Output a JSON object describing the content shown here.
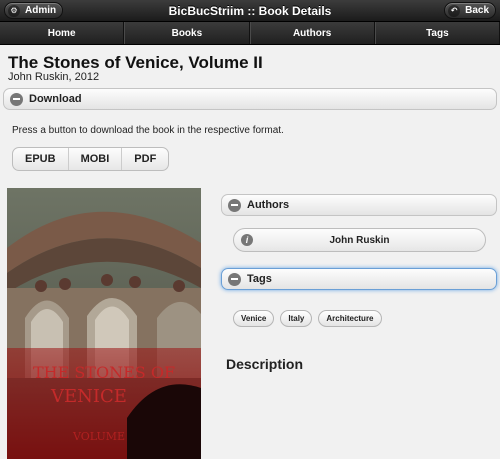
{
  "header": {
    "title": "BicBucStriim :: Book Details",
    "admin_label": "Admin",
    "back_label": "Back"
  },
  "nav": [
    "Home",
    "Books",
    "Authors",
    "Tags"
  ],
  "book": {
    "title": "The Stones of Venice, Volume II",
    "byline": "John Ruskin, 2012",
    "cover": {
      "title_line1": "THE STONES OF",
      "title_line2": "VENICE",
      "volume": "VOLUME"
    }
  },
  "download": {
    "header": "Download",
    "instructions": "Press a button to download the book in the respective format.",
    "formats": [
      "EPUB",
      "MOBI",
      "PDF"
    ]
  },
  "authors": {
    "header": "Authors",
    "items": [
      "John Ruskin"
    ]
  },
  "tags": {
    "header": "Tags",
    "items": [
      "Venice",
      "Italy",
      "Architecture"
    ]
  },
  "description": {
    "header": "Description"
  }
}
